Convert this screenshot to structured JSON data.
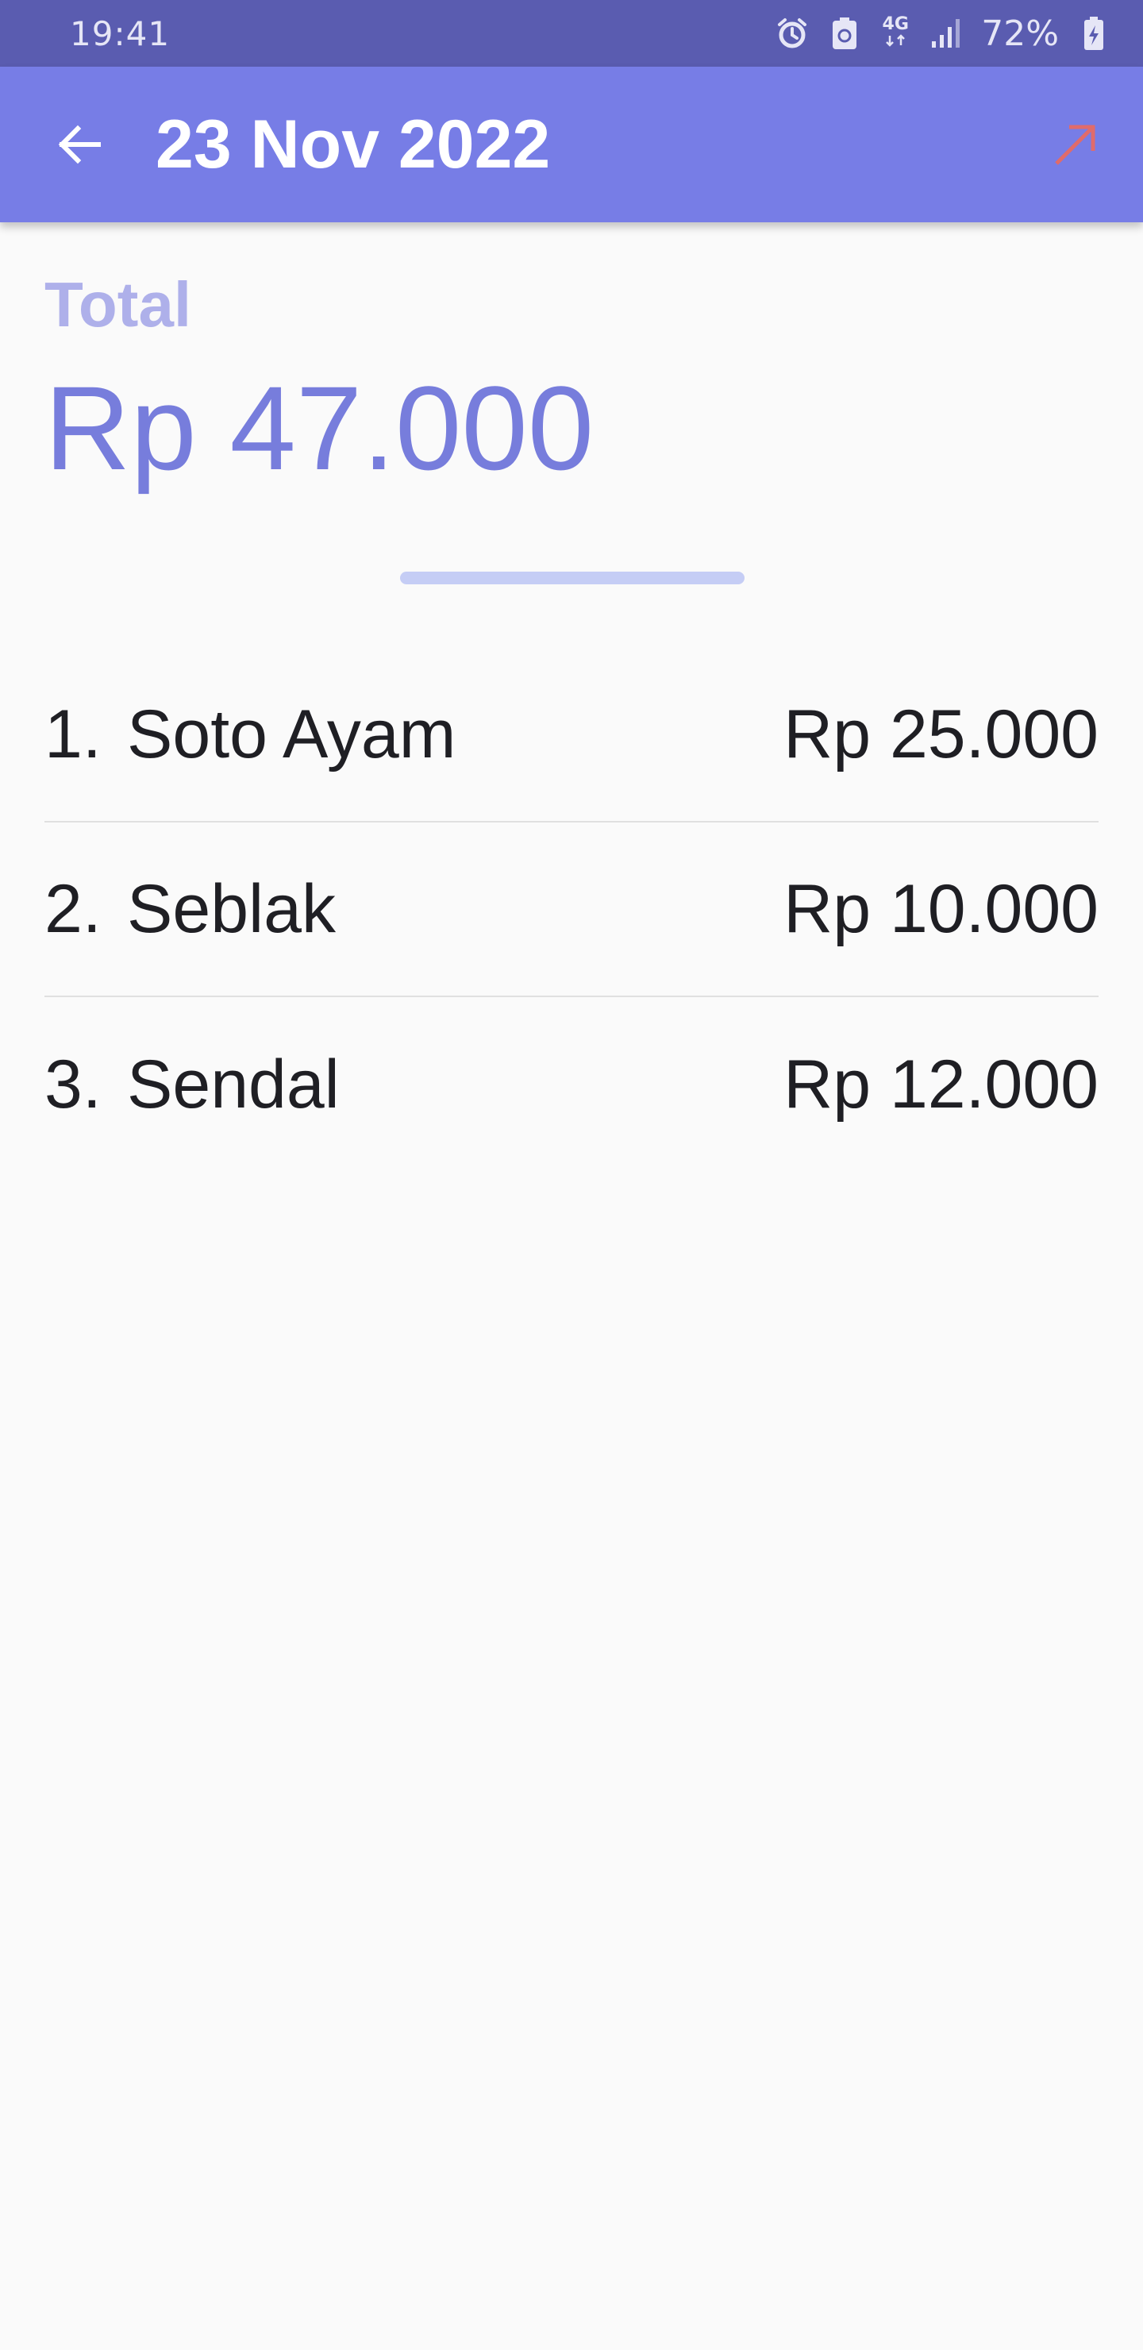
{
  "status_bar": {
    "time": "19:41",
    "network": "4G",
    "battery": "72%",
    "icons": [
      "alarm-icon",
      "recycle-battery-icon",
      "network-4g-icon",
      "signal-icon",
      "battery-charging-icon"
    ]
  },
  "app_bar": {
    "title": "23 Nov 2022",
    "back_icon": "arrow-left-icon",
    "action_icon": "arrow-up-right-icon"
  },
  "summary": {
    "label": "Total",
    "amount": "Rp 47.000"
  },
  "items": [
    {
      "number": "1.",
      "name": "Soto Ayam",
      "price": "Rp 25.000"
    },
    {
      "number": "2.",
      "name": "Seblak",
      "price": "Rp 10.000"
    },
    {
      "number": "3.",
      "name": "Sendal",
      "price": "Rp 12.000"
    }
  ],
  "colors": {
    "status_bar": "#5a5cb0",
    "app_bar": "#777de6",
    "accent": "#777ddc",
    "accent_light": "#aeb0ea",
    "export_icon": "#e06b6b"
  }
}
